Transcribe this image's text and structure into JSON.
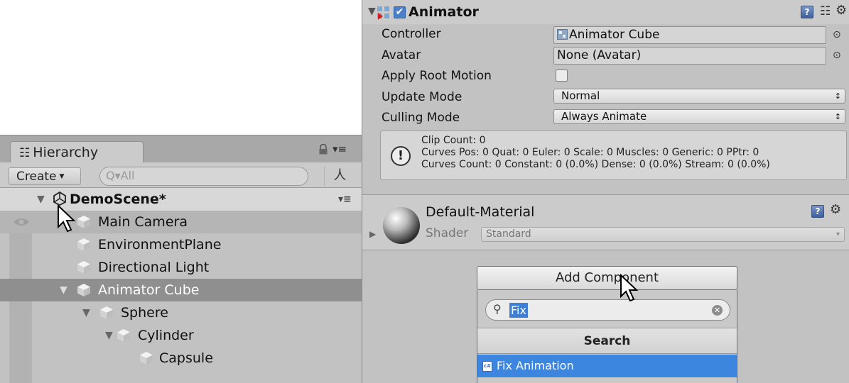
{
  "hierarchy": {
    "tab_label": "Hierarchy",
    "tab_icon": "list-icon",
    "create_label": "Create",
    "search_placeholder": "Q▾All",
    "scene_name": "DemoScene*",
    "items": [
      {
        "label": "Main Camera"
      },
      {
        "label": "EnvironmentPlane"
      },
      {
        "label": "Directional Light"
      },
      {
        "label": "Animator Cube"
      },
      {
        "label": "Sphere"
      },
      {
        "label": "Cylinder"
      },
      {
        "label": "Capsule"
      }
    ]
  },
  "inspector": {
    "animator": {
      "title": "Animator",
      "enabled": true,
      "properties": {
        "controller_label": "Controller",
        "controller_value": "Animator Cube",
        "avatar_label": "Avatar",
        "avatar_value": "None (Avatar)",
        "apply_root_motion_label": "Apply Root Motion",
        "apply_root_motion_checked": false,
        "update_mode_label": "Update Mode",
        "update_mode_value": "Normal",
        "culling_mode_label": "Culling Mode",
        "culling_mode_value": "Always Animate"
      },
      "info": {
        "line1": "Clip Count: 0",
        "line2": "Curves Pos: 0 Quat: 0 Euler: 0 Scale: 0 Muscles: 0 Generic: 0 PPtr: 0",
        "line3": "Curves Count: 0 Constant: 0 (0.0%) Dense: 0 (0.0%) Stream: 0 (0.0%)"
      }
    },
    "material": {
      "name": "Default-Material",
      "shader_label": "Shader",
      "shader_value": "Standard"
    },
    "add_component": {
      "button_label": "Add Component",
      "search_value": "Fix",
      "popup_title": "Search",
      "results": [
        {
          "label": "Fix Animation",
          "icon": "csharp-script-icon"
        }
      ]
    }
  },
  "colors": {
    "panel_bg": "#c2c2c2",
    "selection_blue": "#3d86e0",
    "hierarchy_selected": "#8f8f8f"
  }
}
